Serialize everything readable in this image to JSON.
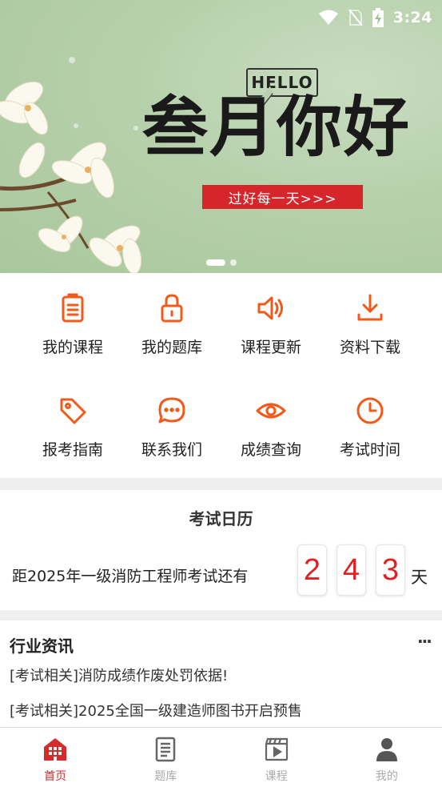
{
  "status_bar": {
    "time": "3:24",
    "icons": [
      "wifi-icon",
      "no-sim-icon",
      "battery-charging-icon"
    ]
  },
  "banner": {
    "hello_text": "HELLO",
    "headline": "叁月你好",
    "slogan": "过好每一天>>>",
    "slides_total": 2,
    "active_slide": 1
  },
  "menu": {
    "items": [
      {
        "label": "我的课程",
        "icon": "clipboard-icon"
      },
      {
        "label": "我的题库",
        "icon": "lock-icon"
      },
      {
        "label": "课程更新",
        "icon": "speaker-icon"
      },
      {
        "label": "资料下载",
        "icon": "download-icon"
      },
      {
        "label": "报考指南",
        "icon": "tag-icon"
      },
      {
        "label": "联系我们",
        "icon": "chat-bubble-icon"
      },
      {
        "label": "成绩查询",
        "icon": "eye-icon"
      },
      {
        "label": "考试时间",
        "icon": "clock-icon"
      }
    ]
  },
  "calendar": {
    "title": "考试日历",
    "countdown_text": "距2025年一级消防工程师考试还有",
    "digits": [
      "2",
      "4",
      "3"
    ],
    "unit": "天"
  },
  "news": {
    "title": "行业资讯",
    "more": "···",
    "items": [
      "[考试相关]消防成绩作废处罚依据!",
      "[考试相关]2025全国一级建造师图书开启预售"
    ]
  },
  "tabbar": {
    "tabs": [
      {
        "label": "首页",
        "icon": "home-icon",
        "active": true
      },
      {
        "label": "题库",
        "icon": "question-bank-icon",
        "active": false
      },
      {
        "label": "课程",
        "icon": "video-course-icon",
        "active": false
      },
      {
        "label": "我的",
        "icon": "user-icon",
        "active": false
      }
    ]
  },
  "colors": {
    "accent": "#f05a1a",
    "tab_active": "#d62b2b",
    "digit": "#e22020",
    "slogan_bg": "#d6262b"
  }
}
